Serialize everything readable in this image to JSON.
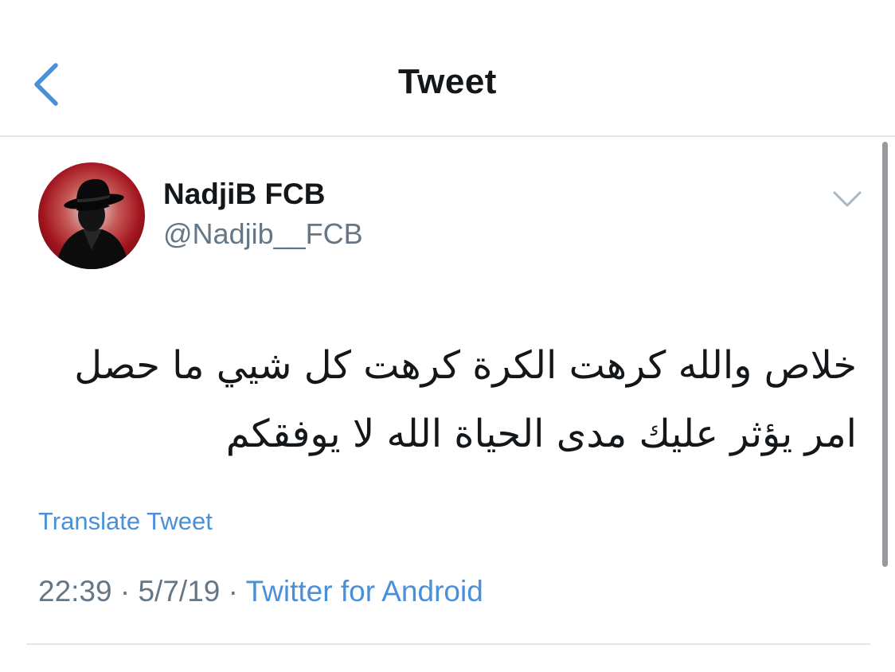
{
  "nav": {
    "title": "Tweet",
    "back_icon": "chevron-left-icon"
  },
  "tweet": {
    "author_name": "NadjiB FCB",
    "author_handle": "@Nadjib__FCB",
    "avatar_icon": "detective-silhouette-avatar",
    "menu_icon": "chevron-down-icon",
    "text_lines": [
      "خلاص والله كرهت الكرة كرهت كل شيي ما حصل",
      "امر يؤثر عليك مدى الحياة الله لا يوفقكم"
    ],
    "translate_label": "Translate Tweet",
    "time": "22:39",
    "date": "5/7/19",
    "separator": "·",
    "source": "Twitter for Android"
  },
  "colors": {
    "link": "#4a90d9",
    "secondary_text": "#657786",
    "divider": "#e1e8ed",
    "avatar_bg": "#a3151f"
  }
}
